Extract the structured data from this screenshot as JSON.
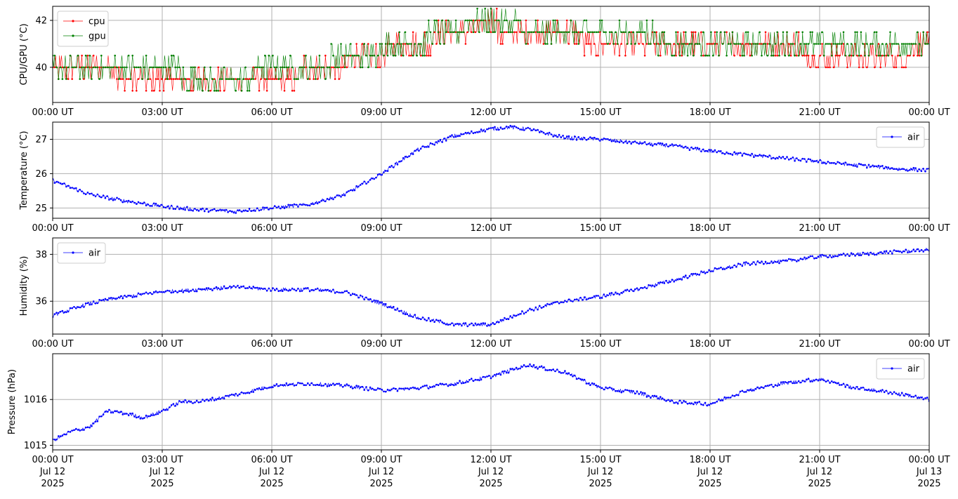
{
  "chart_data": [
    {
      "type": "line",
      "id": "cpu-gpu",
      "ylabel": "CPU/GPU (°C)",
      "ylim": [
        38.5,
        42.6
      ],
      "yticks": [
        40,
        42
      ],
      "x_range_hours": [
        0,
        24
      ],
      "legend_position": "top-left",
      "grid": true,
      "series": [
        {
          "name": "cpu",
          "color": "#ff0000",
          "x_hours": [
            0,
            1,
            2,
            3,
            4,
            5,
            6,
            7,
            8,
            9,
            10,
            11,
            12,
            13,
            14,
            15,
            16,
            17,
            18,
            19,
            20,
            21,
            22,
            23,
            24
          ],
          "values": [
            40.0,
            39.9,
            39.7,
            39.6,
            39.5,
            39.5,
            39.6,
            39.8,
            40.2,
            40.7,
            41.0,
            41.6,
            41.8,
            41.5,
            41.3,
            41.2,
            41.1,
            41.0,
            40.9,
            40.8,
            40.8,
            40.7,
            40.7,
            40.7,
            40.8
          ]
        },
        {
          "name": "gpu",
          "color": "#008000",
          "x_hours": [
            0,
            1,
            2,
            3,
            4,
            5,
            6,
            7,
            8,
            9,
            10,
            11,
            12,
            13,
            14,
            15,
            16,
            17,
            18,
            19,
            20,
            21,
            22,
            23,
            24
          ],
          "values": [
            40.2,
            40.1,
            39.9,
            39.8,
            39.7,
            39.7,
            39.8,
            40.0,
            40.4,
            40.8,
            41.1,
            41.7,
            41.9,
            41.7,
            41.5,
            41.4,
            41.3,
            41.2,
            41.1,
            41.0,
            41.0,
            40.9,
            40.8,
            40.8,
            40.8
          ]
        }
      ]
    },
    {
      "type": "line",
      "id": "air-temp",
      "ylabel": "Temperature (°C)",
      "ylim": [
        24.7,
        27.5
      ],
      "yticks": [
        25,
        26,
        27
      ],
      "x_range_hours": [
        0,
        24
      ],
      "legend_position": "top-right",
      "grid": true,
      "series": [
        {
          "name": "air",
          "color": "#0000ff",
          "x_hours": [
            0,
            1,
            2,
            3,
            4,
            5,
            6,
            7,
            8,
            9,
            10,
            11,
            12,
            12.5,
            13,
            14,
            15,
            16,
            17,
            18,
            19,
            20,
            21,
            22,
            23,
            24
          ],
          "values": [
            25.8,
            25.4,
            25.2,
            25.05,
            24.95,
            24.9,
            25.0,
            25.1,
            25.4,
            26.0,
            26.7,
            27.1,
            27.3,
            27.35,
            27.3,
            27.05,
            27.0,
            26.9,
            26.8,
            26.65,
            26.55,
            26.45,
            26.35,
            26.25,
            26.15,
            26.1
          ]
        }
      ]
    },
    {
      "type": "line",
      "id": "humidity",
      "ylabel": "Humidity (%)",
      "ylim": [
        34.6,
        38.7
      ],
      "yticks": [
        36,
        38
      ],
      "x_range_hours": [
        0,
        24
      ],
      "legend_position": "top-left",
      "grid": true,
      "series": [
        {
          "name": "air",
          "color": "#0000ff",
          "x_hours": [
            0,
            1,
            2,
            3,
            4,
            5,
            6,
            7,
            8,
            9,
            10,
            11,
            12,
            13,
            14,
            15,
            16,
            17,
            18,
            19,
            20,
            21,
            22,
            23,
            24
          ],
          "values": [
            35.4,
            35.9,
            36.2,
            36.4,
            36.5,
            36.6,
            36.5,
            36.5,
            36.4,
            35.9,
            35.3,
            35.0,
            35.0,
            35.6,
            36.0,
            36.2,
            36.5,
            36.9,
            37.3,
            37.6,
            37.7,
            37.9,
            38.0,
            38.1,
            38.2
          ]
        }
      ]
    },
    {
      "type": "line",
      "id": "pressure",
      "ylabel": "Pressure (hPa)",
      "ylim": [
        1014.9,
        1017.0
      ],
      "yticks": [
        1015,
        1016
      ],
      "x_range_hours": [
        0,
        24
      ],
      "legend_position": "top-right",
      "grid": true,
      "series": [
        {
          "name": "air",
          "color": "#0000ff",
          "x_hours": [
            0,
            0.5,
            1,
            1.5,
            2,
            2.5,
            3,
            3.5,
            4,
            5,
            6,
            7,
            8,
            9,
            10,
            11,
            12,
            13,
            14,
            15,
            16,
            17,
            18,
            19,
            20,
            21,
            22,
            23,
            24
          ],
          "values": [
            1015.1,
            1015.3,
            1015.4,
            1015.75,
            1015.7,
            1015.6,
            1015.75,
            1015.95,
            1015.95,
            1016.1,
            1016.3,
            1016.35,
            1016.3,
            1016.2,
            1016.25,
            1016.35,
            1016.5,
            1016.75,
            1016.6,
            1016.25,
            1016.15,
            1015.95,
            1015.9,
            1016.2,
            1016.35,
            1016.45,
            1016.25,
            1016.15,
            1016.0
          ]
        }
      ]
    }
  ],
  "x_tick_labels": [
    "00:00 UT",
    "03:00 UT",
    "06:00 UT",
    "09:00 UT",
    "12:00 UT",
    "15:00 UT",
    "18:00 UT",
    "21:00 UT",
    "00:00 UT"
  ],
  "x_tick_dates": [
    "Jul 12",
    "Jul 12",
    "Jul 12",
    "Jul 12",
    "Jul 12",
    "Jul 12",
    "Jul 12",
    "Jul 12",
    "Jul 13"
  ],
  "x_tick_years": [
    "2025",
    "2025",
    "2025",
    "2025",
    "2025",
    "2025",
    "2025",
    "2025",
    "2025"
  ]
}
